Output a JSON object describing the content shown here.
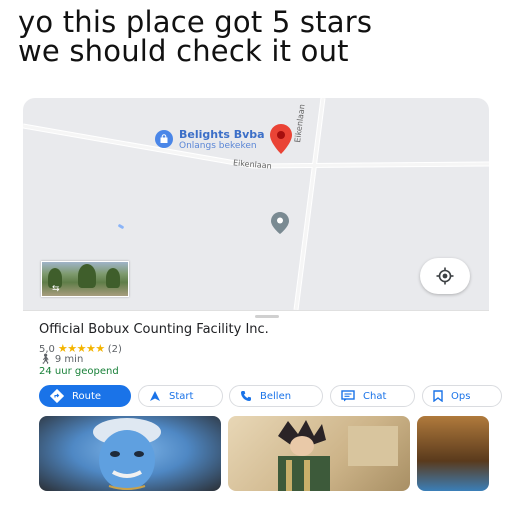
{
  "caption": {
    "line1": "yo this place got 5 stars",
    "line2": "we should check it out"
  },
  "map": {
    "poi_name": "Belights Bvba",
    "poi_sub": "Onlangs bekeken",
    "street_h": "Eikenlaan",
    "street_v": "Eikenlaan",
    "icons": {
      "poi": "shopping-bag-icon",
      "pin": "red-location-pin-icon",
      "pin2": "gray-location-pin-icon",
      "locate": "my-location-icon",
      "street_view": "street-view-thumbnail"
    }
  },
  "place": {
    "name": "Official Bobux Counting Facility Inc.",
    "rating": "5,0",
    "stars": "★★★★★",
    "review_count": "(2)",
    "walk_time": "9 min",
    "hours": "24 uur geopend"
  },
  "actions": {
    "route": "Route",
    "start": "Start",
    "call": "Bellen",
    "chat": "Chat",
    "save": "Ops"
  },
  "colors": {
    "accent": "#1a73e8",
    "star": "#f4b400",
    "open": "#188038",
    "pin": "#ea4335"
  }
}
